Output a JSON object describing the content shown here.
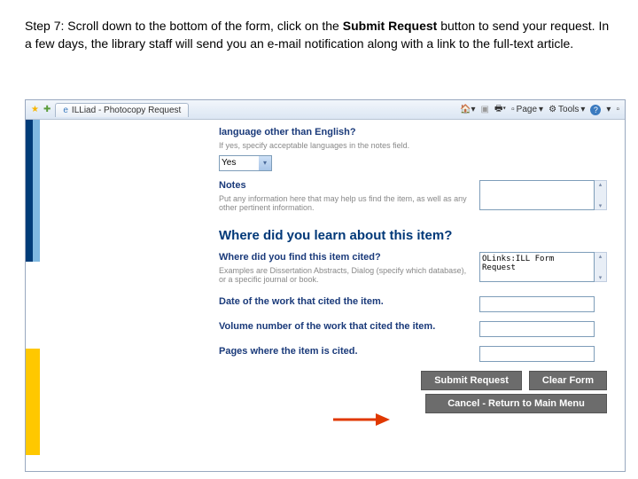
{
  "instruction": {
    "prefix": "Step 7: Scroll down to the bottom of the form, click on the ",
    "bold": "Submit Request",
    "suffix": " button to send your request. In a few days, the library staff will send you an e-mail notification along with a link to the full-text article."
  },
  "tab": {
    "title": "ILLiad - Photocopy Request"
  },
  "toolbar": {
    "page": "Page",
    "tools": "Tools"
  },
  "form": {
    "lang_q": "language other than English?",
    "lang_help": "If yes, specify acceptable languages in the notes field.",
    "lang_value": "Yes",
    "notes_label": "Notes",
    "notes_help": "Put any information here that may help us find the item, as well as any other pertinent information.",
    "section_head": "Where did you learn about this item?",
    "cited_label": "Where did you find this item cited?",
    "cited_help": "Examples are Dissertation Abstracts, Dialog (specify which database), or a specific journal or book.",
    "cited_value": "OLinks:ILL Form Request",
    "date_label": "Date of the work that cited the item.",
    "volume_label": "Volume number of the work that cited the item.",
    "pages_label": "Pages where the item is cited."
  },
  "buttons": {
    "submit": "Submit Request",
    "clear": "Clear Form",
    "cancel": "Cancel - Return to Main Menu"
  }
}
